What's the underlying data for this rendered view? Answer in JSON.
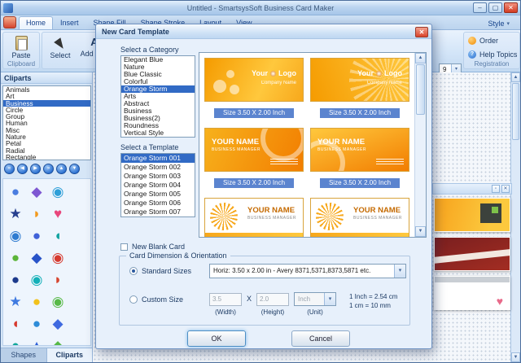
{
  "window": {
    "title": "Untitled - SmartsysSoft Business Card Maker"
  },
  "tabs": [
    "Home",
    "Insert",
    "Shape Fill",
    "Shape Stroke",
    "Layout",
    "View"
  ],
  "style_menu": "Style",
  "ribbon": {
    "paste": "Paste",
    "clipboard_caption": "Clipboard",
    "select": "Select",
    "add_text": "Add Text",
    "font_size": "9",
    "order": "Order",
    "help_topics": "Help Topics",
    "registration_caption": "Registration"
  },
  "cliparts_panel": {
    "title": "Cliparts",
    "categories": [
      "Animals",
      "Art",
      "Business",
      "Circle",
      "Group",
      "Human",
      "Misc",
      "Nature",
      "Petal",
      "Radial",
      "Rectangle"
    ],
    "selected_category": "Business",
    "nav_glyphs": [
      "«",
      "◀",
      "▶",
      "»",
      "▲",
      "▼"
    ],
    "icons": [
      {
        "glyph": "●",
        "color": "#4a7de0"
      },
      {
        "glyph": "◆",
        "color": "#7e57d2"
      },
      {
        "glyph": "◉",
        "color": "#2e9fd8"
      },
      {
        "glyph": "★",
        "color": "#27408f"
      },
      {
        "glyph": "◗",
        "color": "#f29a1f"
      },
      {
        "glyph": "♥",
        "color": "#e8467c"
      },
      {
        "glyph": "◉",
        "color": "#2e7bd0"
      },
      {
        "glyph": "●",
        "color": "#4062d8"
      },
      {
        "glyph": "◖",
        "color": "#12a3a0"
      },
      {
        "glyph": "●",
        "color": "#5cb53a"
      },
      {
        "glyph": "◆",
        "color": "#2853c8"
      },
      {
        "glyph": "◉",
        "color": "#d63a2f"
      },
      {
        "glyph": "●",
        "color": "#1c3a8c"
      },
      {
        "glyph": "◉",
        "color": "#13b0b8"
      },
      {
        "glyph": "◗",
        "color": "#d6452f"
      },
      {
        "glyph": "★",
        "color": "#3f7ae0"
      },
      {
        "glyph": "●",
        "color": "#f2c21c"
      },
      {
        "glyph": "◉",
        "color": "#57b947"
      },
      {
        "glyph": "◖",
        "color": "#d63a2f"
      },
      {
        "glyph": "●",
        "color": "#2e8cd8"
      },
      {
        "glyph": "◆",
        "color": "#3f6ae0"
      },
      {
        "glyph": "●",
        "color": "#12a89a"
      },
      {
        "glyph": "▲",
        "color": "#2e5fd8"
      },
      {
        "glyph": "◆",
        "color": "#57b947"
      }
    ],
    "tabs": [
      "Shapes",
      "Cliparts"
    ],
    "active_tab": "Cliparts"
  },
  "dialog": {
    "title": "New Card Template",
    "category_label": "Select a Category",
    "categories": [
      "Elegant Blue",
      "Nature",
      "Blue Classic",
      "Colorful",
      "Orange Storm",
      "Arts",
      "Abstract",
      "Business",
      "Business(2)",
      "Roundness",
      "Vertical Style"
    ],
    "selected_category": "Orange Storm",
    "template_label": "Select a Template",
    "templates": [
      "Orange Storm 001",
      "Orange Storm 002",
      "Orange Storm 003",
      "Orange Storm 004",
      "Orange Storm 005",
      "Orange Storm 006",
      "Orange Storm 007"
    ],
    "selected_template": "Orange Storm 001",
    "size_caption": "Size 3.50 X 2.00 Inch",
    "cards": [
      {
        "word1": "Your",
        "word2": "Logo",
        "company": "Company Name"
      },
      {
        "word1": "Your",
        "word2": "Logo",
        "company": "Company Name"
      },
      {
        "name": "YOUR NAME",
        "title": "BUSINESS MANAGER"
      },
      {
        "name": "YOUR NAME",
        "title": "BUSINESS MANAGER"
      },
      {
        "name": "YOUR NAME",
        "title": "BUSINESS MANAGER"
      },
      {
        "name": "YOUR NAME",
        "title": "BUSINESS MANAGER"
      }
    ],
    "new_blank_card": "New Blank Card",
    "group_title": "Card Dimension & Orientation",
    "standard_sizes_label": "Standard Sizes",
    "standard_sizes_value": "Horiz: 3.50 x 2.00 in - Avery 8371,5371,8373,5871 etc.",
    "custom_size_label": "Custom Size",
    "width_value": "3.5",
    "width_caption": "(Width)",
    "x_separator": "X",
    "height_value": "2.0",
    "height_caption": "(Height)",
    "unit_value": "Inch",
    "unit_caption": "(Unit)",
    "conversion_line1": "1 Inch = 2.54 cm",
    "conversion_line2": "1 cm = 10 mm",
    "ok": "OK",
    "cancel": "Cancel"
  },
  "colors": {
    "selection": "#316ac5",
    "accent_orange": "#f59b00",
    "dialog_bg": "#e7f0fb"
  }
}
